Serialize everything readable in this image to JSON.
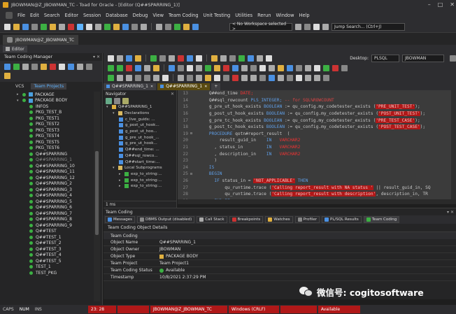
{
  "window": {
    "title": "JBOWMAN@Z_JBOWMAN_TC - Toad for Oracle - [Editor (Q##SPARRING_1)]",
    "controls": [
      "–",
      "□",
      "✕"
    ]
  },
  "menu": [
    "File",
    "Edit",
    "Search",
    "Editor",
    "Session",
    "Database",
    "Debug",
    "View",
    "Team Coding",
    "Unit Testing",
    "Utilities",
    "Rerun",
    "Window",
    "Help"
  ],
  "toolbar": {
    "workspace": "< No Workspace selected >",
    "jump_search": "Jump Search... (Ctrl+J)"
  },
  "connection_tab": "JBOWMAN@Z_JBOWMAN_TC",
  "editor_tab": "Editor",
  "left_panel": {
    "title": "Team Coding Manager",
    "tabs": [
      "VCS",
      "Team Projects"
    ],
    "tree": [
      {
        "label": "PACKAGE",
        "type": "group"
      },
      {
        "label": "PACKAGE BODY",
        "type": "group"
      },
      {
        "label": "INFOS",
        "type": "item"
      },
      {
        "label": "PKG_TEST_B",
        "type": "item"
      },
      {
        "label": "PKG_TEST1",
        "type": "item"
      },
      {
        "label": "PKG_TEST2",
        "type": "item"
      },
      {
        "label": "PKG_TEST3",
        "type": "item"
      },
      {
        "label": "PKG_TEST4",
        "type": "item"
      },
      {
        "label": "PKG_TEST5",
        "type": "item"
      },
      {
        "label": "PKG_TEST6",
        "type": "item"
      },
      {
        "label": "Q##SPARRING",
        "type": "item"
      },
      {
        "label": "Q##SPARRING_1",
        "type": "selected"
      },
      {
        "label": "Q##SPARRING_10",
        "type": "item"
      },
      {
        "label": "Q##SPARRING_11",
        "type": "item"
      },
      {
        "label": "Q##SPARRING_12",
        "type": "item"
      },
      {
        "label": "Q##SPARRING_2",
        "type": "item"
      },
      {
        "label": "Q##SPARRING_3",
        "type": "item"
      },
      {
        "label": "Q##SPARRING_4",
        "type": "item"
      },
      {
        "label": "Q##SPARRING_5",
        "type": "item"
      },
      {
        "label": "Q##SPARRING_6",
        "type": "item"
      },
      {
        "label": "Q##SPARRING_7",
        "type": "item"
      },
      {
        "label": "Q##SPARRING_8",
        "type": "item"
      },
      {
        "label": "Q##SPARRING_9",
        "type": "item"
      },
      {
        "label": "Q##TEST",
        "type": "item"
      },
      {
        "label": "Q##TEST_1",
        "type": "item"
      },
      {
        "label": "Q##TEST_2",
        "type": "item"
      },
      {
        "label": "Q##TEST_3",
        "type": "item"
      },
      {
        "label": "Q##TEST_4",
        "type": "item"
      },
      {
        "label": "Q##TEST_5",
        "type": "item"
      },
      {
        "label": "TEST_1",
        "type": "item"
      },
      {
        "label": "TEST_PKG",
        "type": "item"
      }
    ]
  },
  "right_toolbar": {
    "desktop_label": "Desktop:",
    "desktop_value": "PLSQL",
    "schema_value": "JBOWMAN"
  },
  "sub_tabs": [
    {
      "label": "Q##SPARRING_1",
      "active": false
    },
    {
      "label": "Q##SPARRING_1",
      "active": true
    },
    {
      "label": "+",
      "active": false
    }
  ],
  "navigator": {
    "title": "Navigator",
    "nodes": [
      {
        "label": "Q##SPARRING_1",
        "depth": 0,
        "kind": "pkg"
      },
      {
        "label": "Declarations",
        "depth": 1,
        "kind": "folder"
      },
      {
        "label": "c_live_guids: ...",
        "depth": 2,
        "kind": "var"
      },
      {
        "label": "g_post_ut_hook...",
        "depth": 2,
        "kind": "var"
      },
      {
        "label": "g_post_ut_hoo...",
        "depth": 2,
        "kind": "var"
      },
      {
        "label": "g_pre_ut_hook_...",
        "depth": 2,
        "kind": "var"
      },
      {
        "label": "g_pre_ut_hook...",
        "depth": 2,
        "kind": "var"
      },
      {
        "label": "Q##end_time: ...",
        "depth": 2,
        "kind": "var"
      },
      {
        "label": "Q##sql_rowco...",
        "depth": 2,
        "kind": "var"
      },
      {
        "label": "Q##start_time:...",
        "depth": 2,
        "kind": "var"
      },
      {
        "label": "Local Subprograms",
        "depth": 1,
        "kind": "folder"
      },
      {
        "label": "exp_to_string:...",
        "depth": 2,
        "kind": "func"
      },
      {
        "label": "exp_to_string:...",
        "depth": 2,
        "kind": "func"
      },
      {
        "label": "exp_to_string:...",
        "depth": 2,
        "kind": "func"
      }
    ],
    "footer": "1 ms"
  },
  "code": {
    "lines": [
      {
        "n": "13",
        "parts": [
          [
            "tx",
            "    Q##end_time "
          ],
          [
            "st",
            "DATE;"
          ]
        ]
      },
      {
        "n": "14",
        "parts": [
          [
            "tx",
            "    Q##sql_rowcount "
          ],
          [
            "kw",
            "PLS_INTEGER;"
          ],
          [
            "cm",
            " -- for SQL%ROWCOUNT"
          ]
        ]
      },
      {
        "n": "15",
        "parts": [
          [
            "tx",
            "    g_pre_ut_hook_exists "
          ],
          [
            "kw",
            "BOOLEAN"
          ],
          [
            "tx",
            " := qu_config.my_codetester_exists ("
          ],
          [
            "hl",
            "'PRE_UNIT_TEST'"
          ],
          [
            "tx",
            ");"
          ]
        ]
      },
      {
        "n": "16",
        "parts": [
          [
            "tx",
            "    g_post_ut_hook_exists "
          ],
          [
            "kw",
            "BOOLEAN"
          ],
          [
            "tx",
            " := qu_config.my_codetester_exists ("
          ],
          [
            "hl",
            "'POST_UNIT_TEST'"
          ],
          [
            "tx",
            ");"
          ]
        ]
      },
      {
        "n": "17",
        "parts": [
          [
            "tx",
            "    g_pre_tc_hook_exists "
          ],
          [
            "kw",
            "BOOLEAN"
          ],
          [
            "tx",
            " := qu_config.my_codetester_exists ("
          ],
          [
            "hl",
            "'PRE_TEST_CASE'"
          ],
          [
            "tx",
            ");"
          ]
        ]
      },
      {
        "n": "18",
        "parts": [
          [
            "tx",
            "    g_post_tc_hook_exists "
          ],
          [
            "kw",
            "BOOLEAN"
          ],
          [
            "tx",
            " := qu_config.my_codetester_exists ("
          ],
          [
            "hl",
            "'POST_TEST_CASE'"
          ],
          [
            "tx",
            ");"
          ]
        ]
      },
      {
        "n": "19",
        "parts": [
          [
            "kw",
            "    PROCEDURE"
          ],
          [
            "tx",
            " qotn#report_result  ("
          ]
        ]
      },
      {
        "n": "20",
        "parts": [
          [
            "tx",
            "        result_guid_in    "
          ],
          [
            "kw",
            "IN"
          ],
          [
            "tx",
            "   "
          ],
          [
            "st",
            "VARCHAR2"
          ]
        ]
      },
      {
        "n": "21",
        "parts": [
          [
            "tx",
            "      , status_in         "
          ],
          [
            "kw",
            "IN"
          ],
          [
            "tx",
            "   "
          ],
          [
            "st",
            "VARCHAR2"
          ]
        ]
      },
      {
        "n": "22",
        "parts": [
          [
            "tx",
            "      , description_in    "
          ],
          [
            "kw",
            "IN"
          ],
          [
            "tx",
            "   "
          ],
          [
            "st",
            "VARCHAR2"
          ]
        ]
      },
      {
        "n": "23",
        "parts": [
          [
            "tx",
            "      )"
          ]
        ]
      },
      {
        "n": "24",
        "parts": [
          [
            "kw",
            "    IS"
          ]
        ]
      },
      {
        "n": "25",
        "parts": [
          [
            "kw",
            "    BEGIN"
          ]
        ]
      },
      {
        "n": "26",
        "parts": [
          [
            "kw",
            "      IF"
          ],
          [
            "tx",
            " status_in = "
          ],
          [
            "hl",
            "'NOT_APPLICABLE'"
          ],
          [
            "kw",
            " THEN"
          ]
        ]
      },
      {
        "n": "27",
        "parts": [
          [
            "tx",
            "          qu_runtime.trace ("
          ],
          [
            "hl",
            "'Calling report_result with NA status '"
          ],
          [
            "tx",
            " || result_guid_in, SQ"
          ]
        ]
      },
      {
        "n": "28",
        "parts": [
          [
            "tx",
            "          qu_runtime.trace ("
          ],
          [
            "hl",
            "'Calling report_result with description'"
          ],
          [
            "tx",
            ", description_in, TR"
          ]
        ]
      },
      {
        "n": "29",
        "parts": [
          [
            "kw",
            "      END IF;"
          ]
        ]
      }
    ]
  },
  "bottom": {
    "title": "Team Coding",
    "tabs": [
      "Messages",
      "DBMS Output (disabled)",
      "Call Stack",
      "Breakpoints",
      "Watches",
      "Profiler",
      "PL/SQL Results",
      "Team Coding"
    ],
    "header": "Team Coding Object Details",
    "group": "Team Coding",
    "rows": [
      {
        "k": "Object Name",
        "v": "Q##SPARRING_1"
      },
      {
        "k": "Object Owner",
        "v": "JBOWMAN"
      },
      {
        "k": "Object Type",
        "v": "PACKAGE BODY"
      },
      {
        "k": "Team Project",
        "v": "Team Project1"
      },
      {
        "k": "Team Coding Status",
        "v": "Available"
      },
      {
        "k": "Timestamp",
        "v": "10/8/2021 2:37:29 PM"
      }
    ]
  },
  "status_bar": {
    "caps": "CAPS",
    "num": "NUM",
    "ins": "INS",
    "position": "23: 28",
    "connection": "JBOWMAN@Z_JBOWMAN_TC",
    "line_endings": "Windows (CRLF)",
    "tc_status": "Available"
  },
  "watermark": "微信号: cogitosoftware",
  "colors": {
    "accent_red": "#b01818",
    "status_green": "#3cb043",
    "keyword_blue": "#5f9fe8",
    "active_tab_gold": "#5a4a10"
  }
}
